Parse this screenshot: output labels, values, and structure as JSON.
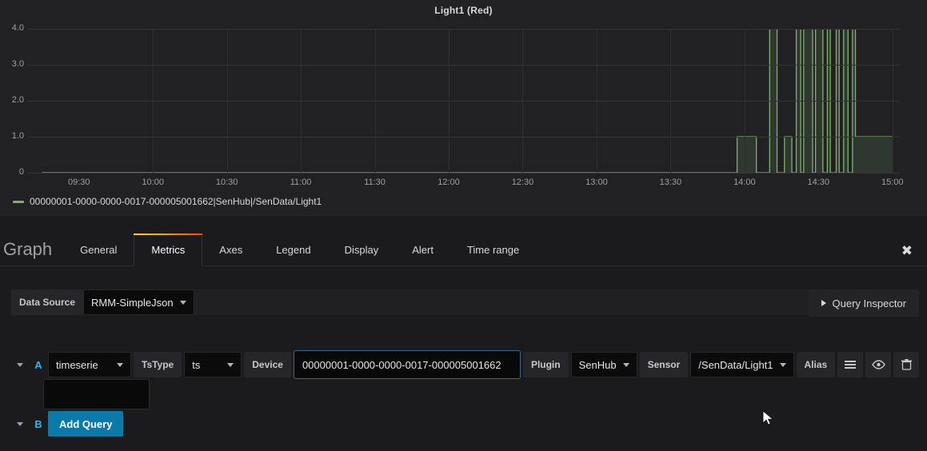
{
  "panel": {
    "title": "Light1 (Red)",
    "legend": {
      "label": "00000001-0000-0000-0017-000005001662|SenHub|/SenData/Light1",
      "color": "#7eb26d"
    }
  },
  "chart_data": {
    "type": "line",
    "title": "Light1 (Red)",
    "xlabel": "",
    "ylabel": "",
    "grid": true,
    "legend_position": "bottom-left",
    "series": [
      {
        "name": "00000001-0000-0000-0017-000005001662|SenHub|/SenData/Light1",
        "color": "#7eb26d",
        "fill": true,
        "step": true,
        "points": [
          [
            9.25,
            0
          ],
          [
            13.95,
            0
          ],
          [
            13.95,
            1
          ],
          [
            14.08,
            1
          ],
          [
            14.08,
            0
          ],
          [
            14.17,
            0
          ],
          [
            14.17,
            4
          ],
          [
            14.22,
            4
          ],
          [
            14.22,
            0
          ],
          [
            14.27,
            0
          ],
          [
            14.27,
            1
          ],
          [
            14.32,
            1
          ],
          [
            14.32,
            0
          ],
          [
            14.35,
            0
          ],
          [
            14.35,
            4
          ],
          [
            14.38,
            4
          ],
          [
            14.38,
            0
          ],
          [
            14.4,
            0
          ],
          [
            14.4,
            4
          ],
          [
            14.46,
            4
          ],
          [
            14.46,
            0
          ],
          [
            14.48,
            0
          ],
          [
            14.48,
            4
          ],
          [
            14.53,
            4
          ],
          [
            14.53,
            0
          ],
          [
            14.56,
            0
          ],
          [
            14.56,
            4
          ],
          [
            14.58,
            4
          ],
          [
            14.58,
            0
          ],
          [
            14.62,
            0
          ],
          [
            14.62,
            4
          ],
          [
            14.64,
            4
          ],
          [
            14.64,
            0
          ],
          [
            14.67,
            0
          ],
          [
            14.67,
            4
          ],
          [
            14.7,
            4
          ],
          [
            14.7,
            0
          ],
          [
            14.73,
            0
          ],
          [
            14.73,
            4
          ],
          [
            14.75,
            4
          ],
          [
            14.75,
            1
          ],
          [
            15.0,
            1
          ]
        ]
      }
    ],
    "xaxis": {
      "ticks": [
        "09:30",
        "10:00",
        "10:30",
        "11:00",
        "11:30",
        "12:00",
        "12:30",
        "13:00",
        "13:30",
        "14:00",
        "14:30",
        "15:00"
      ],
      "min": 9.15,
      "max": 15.05
    },
    "yaxis": {
      "ticks": [
        "0",
        "1.0",
        "2.0",
        "3.0",
        "4.0"
      ],
      "min": 0,
      "max": 4
    }
  },
  "editor": {
    "heading": "Graph",
    "tabs": [
      {
        "label": "General",
        "active": false
      },
      {
        "label": "Metrics",
        "active": true
      },
      {
        "label": "Axes",
        "active": false
      },
      {
        "label": "Legend",
        "active": false
      },
      {
        "label": "Display",
        "active": false
      },
      {
        "label": "Alert",
        "active": false
      },
      {
        "label": "Time range",
        "active": false
      }
    ],
    "close_label": "✖",
    "datasource": {
      "label": "Data Source",
      "value": "RMM-SimpleJson"
    },
    "query_inspector": "Query Inspector",
    "queries": [
      {
        "letter": "A",
        "type": "timeserie",
        "tstype_label": "TsType",
        "tstype_value": "ts",
        "device_label": "Device",
        "device_value": "00000001-0000-0000-0017-000005001662",
        "plugin_label": "Plugin",
        "plugin_value": "SenHub",
        "sensor_label": "Sensor",
        "sensor_value": "/SenData/Light1",
        "alias_label": "Alias",
        "actions": [
          "hamburger-icon",
          "eye-icon",
          "trash-icon"
        ]
      },
      {
        "letter": "B",
        "add_query_label": "Add Query"
      }
    ]
  }
}
